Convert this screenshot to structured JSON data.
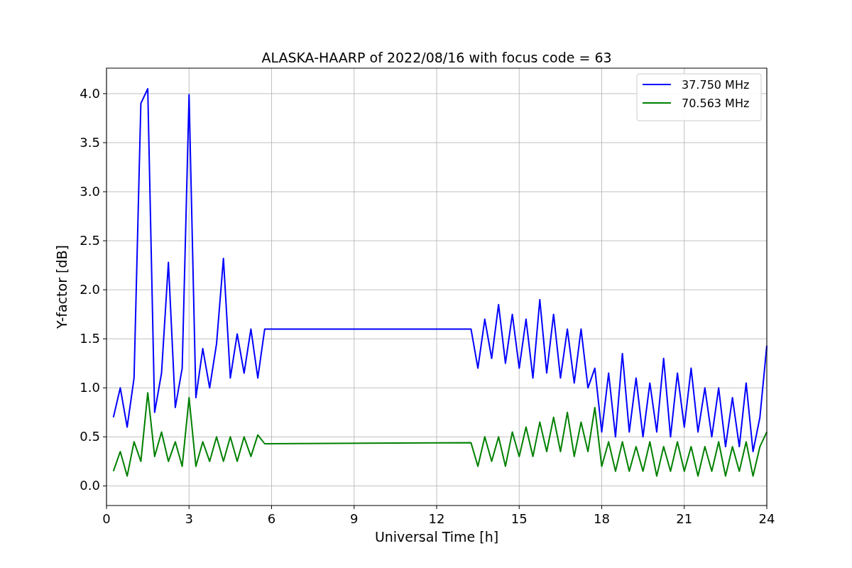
{
  "chart_data": {
    "type": "line",
    "title": "ALASKA-HAARP of 2022/08/16 with focus code = 63",
    "xlabel": "Universal Time [h]",
    "ylabel": "Y-factor [dB]",
    "x": [
      0.25,
      0.5,
      0.75,
      1.0,
      1.25,
      1.5,
      1.75,
      2.0,
      2.25,
      2.5,
      2.75,
      3.0,
      3.25,
      3.5,
      3.75,
      4.0,
      4.25,
      4.5,
      4.75,
      5.0,
      5.25,
      5.5,
      5.75,
      13.25,
      13.5,
      13.75,
      14.0,
      14.25,
      14.5,
      14.75,
      15.0,
      15.25,
      15.5,
      15.75,
      16.0,
      16.25,
      16.5,
      16.75,
      17.0,
      17.25,
      17.5,
      17.75,
      18.0,
      18.25,
      18.5,
      18.75,
      19.0,
      19.25,
      19.5,
      19.75,
      20.0,
      20.25,
      20.5,
      20.75,
      21.0,
      21.25,
      21.5,
      21.75,
      22.0,
      22.25,
      22.5,
      22.75,
      23.0,
      23.25,
      23.5,
      23.75,
      24.0
    ],
    "series": [
      {
        "name": "37.750 MHz",
        "color": "#0000ff",
        "values": [
          0.7,
          1.0,
          0.6,
          1.1,
          3.9,
          4.05,
          0.75,
          1.15,
          2.28,
          0.8,
          1.2,
          3.99,
          0.9,
          1.4,
          1.0,
          1.45,
          2.32,
          1.1,
          1.55,
          1.15,
          1.6,
          1.1,
          1.6,
          1.6,
          1.2,
          1.7,
          1.3,
          1.85,
          1.25,
          1.75,
          1.2,
          1.7,
          1.1,
          1.9,
          1.15,
          1.75,
          1.1,
          1.6,
          1.05,
          1.6,
          1.0,
          1.2,
          0.55,
          1.15,
          0.5,
          1.35,
          0.55,
          1.1,
          0.5,
          1.05,
          0.55,
          1.3,
          0.5,
          1.15,
          0.6,
          1.2,
          0.55,
          1.0,
          0.5,
          1.0,
          0.4,
          0.9,
          0.4,
          1.05,
          0.35,
          0.7,
          1.43
        ]
      },
      {
        "name": "70.563 MHz",
        "color": "#008000",
        "values": [
          0.15,
          0.35,
          0.1,
          0.45,
          0.25,
          0.95,
          0.3,
          0.55,
          0.25,
          0.45,
          0.2,
          0.9,
          0.2,
          0.45,
          0.25,
          0.5,
          0.25,
          0.5,
          0.25,
          0.5,
          0.3,
          0.52,
          0.43,
          0.44,
          0.2,
          0.5,
          0.25,
          0.5,
          0.2,
          0.55,
          0.3,
          0.6,
          0.3,
          0.65,
          0.35,
          0.7,
          0.35,
          0.75,
          0.3,
          0.65,
          0.35,
          0.8,
          0.2,
          0.45,
          0.15,
          0.45,
          0.15,
          0.4,
          0.15,
          0.45,
          0.1,
          0.4,
          0.15,
          0.45,
          0.15,
          0.4,
          0.1,
          0.4,
          0.15,
          0.45,
          0.1,
          0.4,
          0.15,
          0.45,
          0.1,
          0.4,
          0.55
        ]
      }
    ],
    "grid": true,
    "legend": true,
    "xlim": [
      0,
      24
    ],
    "ylim": [
      -0.2,
      4.26
    ],
    "xticks": [
      0,
      3,
      6,
      9,
      12,
      15,
      18,
      21,
      24
    ],
    "yticks": [
      {
        "value": 0,
        "label": "0.0"
      },
      {
        "value": 0.5,
        "label": "0.5"
      },
      {
        "value": 1,
        "label": "1.0"
      },
      {
        "value": 1.5,
        "label": "1.5"
      },
      {
        "value": 2,
        "label": "2.0"
      },
      {
        "value": 2.5,
        "label": "2.5"
      },
      {
        "value": 3,
        "label": "3.0"
      },
      {
        "value": 3.5,
        "label": "3.5"
      },
      {
        "value": 4,
        "label": "4.0"
      }
    ]
  }
}
